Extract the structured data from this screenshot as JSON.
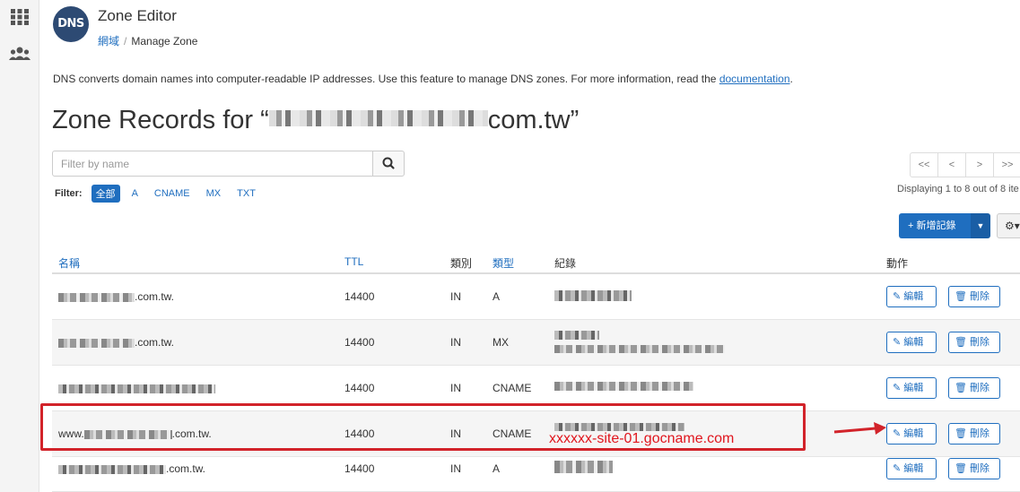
{
  "app": {
    "title": "Zone Editor",
    "logo_text": "DNS",
    "breadcrumb_link": "網域",
    "breadcrumb_current": "Manage Zone"
  },
  "description": {
    "text": "DNS converts domain names into computer-readable IP addresses. Use this feature to manage DNS zones. For more information, read the ",
    "link": "documentation",
    "tail": "."
  },
  "heading": {
    "prefix": "Zone Records for “",
    "suffix": "com.tw”"
  },
  "search": {
    "placeholder": "Filter by name"
  },
  "filter": {
    "label": "Filter:",
    "chips": [
      "全部",
      "A",
      "CNAME",
      "MX",
      "TXT"
    ]
  },
  "pager": {
    "buttons": [
      "<<",
      "<",
      ">",
      ">>"
    ],
    "info": "Displaying 1 to 8 out of 8 ite"
  },
  "toolbar": {
    "add_label": "+ 新增記錄"
  },
  "table": {
    "headers": [
      "名稱",
      "TTL",
      "類別",
      "類型",
      "紀錄",
      "動作"
    ],
    "edit_label": "編輯",
    "delete_label": "刪除",
    "rows": [
      {
        "name": ".com.tw.",
        "ttl": "14400",
        "class": "IN",
        "type": "A"
      },
      {
        "name": ".com.tw.",
        "ttl": "14400",
        "class": "IN",
        "type": "MX"
      },
      {
        "name": "",
        "ttl": "14400",
        "class": "IN",
        "type": "CNAME"
      },
      {
        "name_prefix": "www.",
        "name": ".com.tw.",
        "ttl": "14400",
        "class": "IN",
        "type": "CNAME"
      },
      {
        "name": ".com.tw.",
        "ttl": "14400",
        "class": "IN",
        "type": "A"
      }
    ]
  },
  "annotation": {
    "text": "xxxxxx-site-01.gocname.com",
    "color": "#e0161e"
  },
  "colors": {
    "accent": "#1f6ebf",
    "highlight": "#d2232a"
  }
}
